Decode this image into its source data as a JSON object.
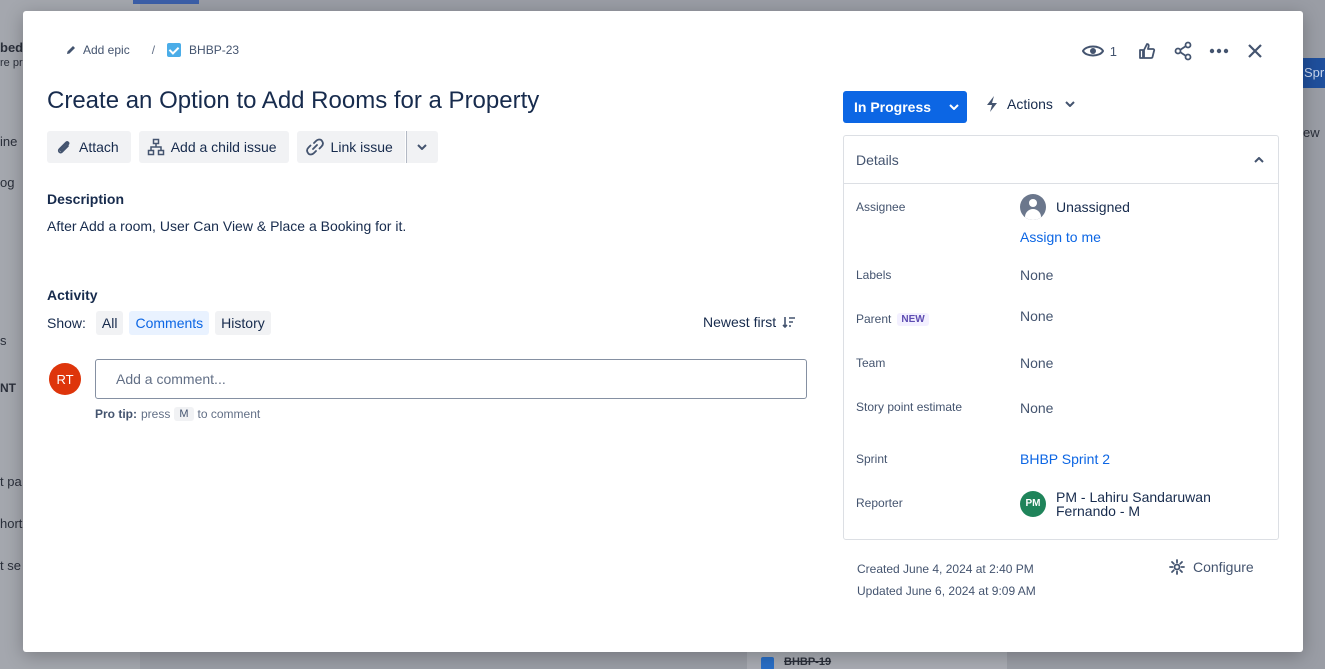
{
  "background": {
    "left_texts": [
      "bed",
      "re pr",
      "ine",
      "og",
      "s",
      "NT",
      "t pa",
      "hort",
      "t se"
    ],
    "right_button": "Sprin",
    "right_text": "ew",
    "bottom_card_key": "BHBP-19"
  },
  "breadcrumb": {
    "add_epic": "Add epic",
    "separator": "/",
    "issue_key": "BHBP-23"
  },
  "header": {
    "watch_count": "1"
  },
  "issue": {
    "title": "Create an Option to Add Rooms for a Property",
    "buttons": {
      "attach": "Attach",
      "add_child": "Add a child issue",
      "link_issue": "Link issue"
    },
    "description_heading": "Description",
    "description": "After Add a room, User Can View & Place a Booking for it."
  },
  "activity": {
    "heading": "Activity",
    "show_label": "Show:",
    "filters": [
      "All",
      "Comments",
      "History"
    ],
    "sort_label": "Newest first",
    "avatar_initials": "RT",
    "comment_placeholder": "Add a comment...",
    "protip_bold": "Pro tip:",
    "protip_press": "press",
    "protip_key": "M",
    "protip_rest": "to comment"
  },
  "status": {
    "label": "In Progress",
    "actions_label": "Actions"
  },
  "details": {
    "heading": "Details",
    "assignee_label": "Assignee",
    "assignee_value": "Unassigned",
    "assign_to_me": "Assign to me",
    "labels_label": "Labels",
    "labels_value": "None",
    "parent_label": "Parent",
    "parent_badge": "NEW",
    "parent_value": "None",
    "team_label": "Team",
    "team_value": "None",
    "story_label": "Story point estimate",
    "story_value": "None",
    "sprint_label": "Sprint",
    "sprint_value": "BHBP Sprint 2",
    "reporter_label": "Reporter",
    "reporter_initials": "PM",
    "reporter_line1": "PM - Lahiru Sandaruwan",
    "reporter_line2": "Fernando - M"
  },
  "meta": {
    "created": "Created June 4, 2024 at 2:40 PM",
    "updated": "Updated June 6, 2024 at 9:09 AM",
    "configure": "Configure"
  }
}
